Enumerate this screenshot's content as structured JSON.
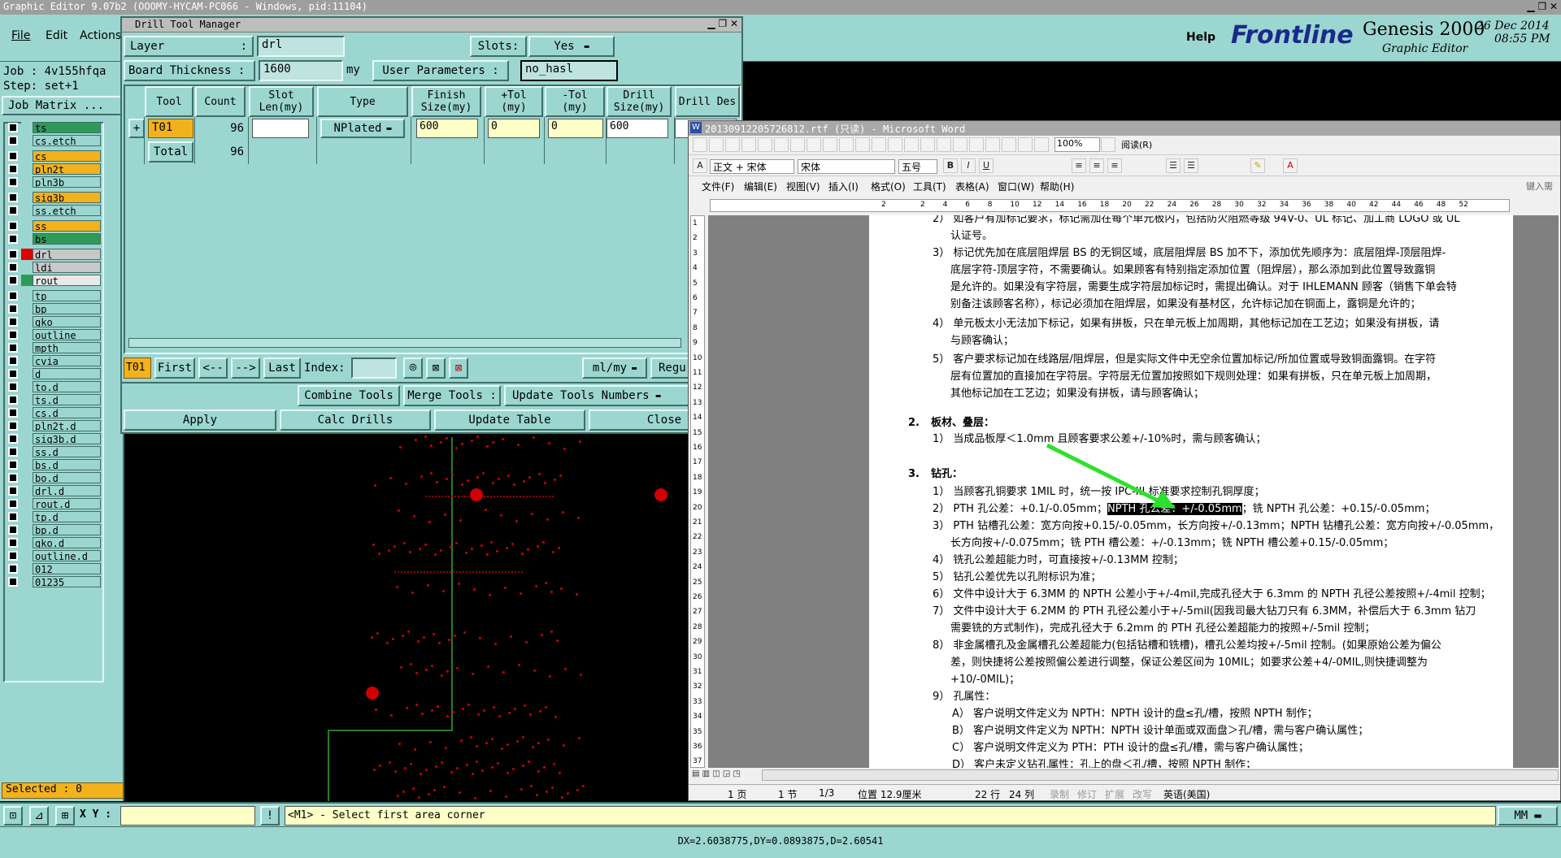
{
  "genesis": {
    "title": "Graphic Editor 9.07b2 (OOOMY-HYCAM-PC066 - Windows, pid:11104)",
    "menu": [
      "File",
      "Edit",
      "Actions"
    ],
    "help": "Help",
    "brand": "Frontline",
    "product": "Genesis 2000",
    "subtitle": "Graphic Editor",
    "date": "26 Dec 2014",
    "time": "08:55 PM",
    "job": "Job : 4v155hfqa",
    "step": "Step: set+1",
    "job_matrix": "Job Matrix ...",
    "selected": "Selected : 0",
    "xy_label": "X Y :",
    "xy_value": "",
    "status_message": "<M1> - Select first area corner",
    "units": "MM",
    "bottom_readout": "DX=2.6038775,DY=0.0893875,D=2.60541",
    "layers": [
      {
        "name": "ts",
        "color": "#2f9a58"
      },
      {
        "name": "cs.etch",
        "color": "#9cd6d0"
      },
      {
        "name": "cs",
        "color": "#f2b21e"
      },
      {
        "name": "pln2t",
        "color": "#f2b21e"
      },
      {
        "name": "pln3b",
        "color": "#9cd6d0"
      },
      {
        "name": "sig3b",
        "color": "#f2b21e"
      },
      {
        "name": "ss.etch",
        "color": "#9cd6d0"
      },
      {
        "name": "ss",
        "color": "#f2b21e"
      },
      {
        "name": "bs",
        "color": "#2f9a58"
      },
      {
        "name": "drl",
        "color": "#c8c8c8"
      },
      {
        "name": "ldi",
        "color": "#c8c8c8"
      },
      {
        "name": "rout",
        "color": "#e8e8e8"
      },
      {
        "name": "tp",
        "color": "#9cd6d0"
      },
      {
        "name": "bp",
        "color": "#9cd6d0"
      },
      {
        "name": "gko",
        "color": "#9cd6d0"
      },
      {
        "name": "outline",
        "color": "#9cd6d0"
      },
      {
        "name": "mpth",
        "color": "#9cd6d0"
      },
      {
        "name": "cvia",
        "color": "#9cd6d0"
      },
      {
        "name": "d",
        "color": "#9cd6d0"
      },
      {
        "name": "to.d",
        "color": "#9cd6d0"
      },
      {
        "name": "ts.d",
        "color": "#9cd6d0"
      },
      {
        "name": "cs.d",
        "color": "#9cd6d0"
      },
      {
        "name": "pln2t.d",
        "color": "#9cd6d0"
      },
      {
        "name": "sig3b.d",
        "color": "#9cd6d0"
      },
      {
        "name": "ss.d",
        "color": "#9cd6d0"
      },
      {
        "name": "bs.d",
        "color": "#9cd6d0"
      },
      {
        "name": "bo.d",
        "color": "#9cd6d0"
      },
      {
        "name": "drl.d",
        "color": "#9cd6d0"
      },
      {
        "name": "rout.d",
        "color": "#9cd6d0"
      },
      {
        "name": "tp.d",
        "color": "#9cd6d0"
      },
      {
        "name": "bp.d",
        "color": "#9cd6d0"
      },
      {
        "name": "gko.d",
        "color": "#9cd6d0"
      },
      {
        "name": "outline.d",
        "color": "#9cd6d0"
      },
      {
        "name": "012",
        "color": "#9cd6d0"
      },
      {
        "name": "01235",
        "color": "#9cd6d0"
      }
    ]
  },
  "drill": {
    "title": "Drill Tool Manager",
    "layer_label": "Layer",
    "layer_colon": ":",
    "layer_value": "drl",
    "slots_label": "Slots:",
    "slots_value": "Yes",
    "thickness_label": "Board Thickness :",
    "thickness_value": "1600",
    "thickness_unit": "my",
    "user_params_label": "User Parameters :",
    "user_params_value": "no_hasl",
    "headers": [
      "Tool",
      "Count",
      "Slot Len(my)",
      "Type",
      "Finish Size(my)",
      "+Tol (my)",
      "-Tol (my)",
      "Drill Size(my)",
      "Drill Des"
    ],
    "row": {
      "tool": "T01",
      "count": "96",
      "slot": "",
      "type": "NPlated",
      "finish": "600",
      "ptol": "0",
      "ntol": "0",
      "drill": "600"
    },
    "total_label": "Total",
    "total_count": "96",
    "nav": {
      "current": "T01",
      "first": "First",
      "prev": "<--",
      "next": "-->",
      "last": "Last",
      "index": "Index:",
      "units": "ml/my",
      "regu": "Regu"
    },
    "combine": "Combine Tools",
    "merge": "Merge Tools :",
    "update_numbers": "Update Tools Numbers",
    "apply": "Apply",
    "calc": "Calc Drills",
    "update_table": "Update Table",
    "close": "Close"
  },
  "word": {
    "title": "20130912205726812.rtf (只读) - Microsoft Word",
    "zoom": "100%",
    "read_btn": "阅读(R)",
    "style": "正文 + 宋体",
    "font": "宋体",
    "size": "五号",
    "menus": [
      "文件(F)",
      "编辑(E)",
      "视图(V)",
      "插入(I)",
      "格式(O)",
      "工具(T)",
      "表格(A)",
      "窗口(W)",
      "帮助(H)"
    ],
    "ask": "键入需",
    "ruler": [
      "2",
      "2",
      "4",
      "6",
      "8",
      "10",
      "12",
      "14",
      "16",
      "18",
      "20",
      "22",
      "24",
      "26",
      "28",
      "30",
      "32",
      "34",
      "36",
      "38",
      "40",
      "42",
      "44",
      "46",
      "48",
      "52"
    ],
    "vruler": [
      "1",
      "2",
      "3",
      "4",
      "5",
      "6",
      "7",
      "8",
      "9",
      "10",
      "11",
      "12",
      "13",
      "14",
      "15",
      "16",
      "17",
      "18",
      "19",
      "20",
      "21",
      "22",
      "23",
      "24",
      "25",
      "26",
      "27",
      "28",
      "29",
      "30",
      "31",
      "32",
      "33",
      "34",
      "35",
      "36",
      "37"
    ],
    "status": {
      "page": "1 页",
      "section": "1 节",
      "pages": "1/3",
      "pos": "位置 12.9厘米",
      "line": "22 行",
      "col": "24 列",
      "rec": "录制",
      "trk": "修订",
      "ext": "扩展",
      "ovr": "改写",
      "lang": "英语(美国)"
    },
    "lines": [
      "2） 如客户有加标记要求，标记需加在每个单元板内，包括防火阻燃等级 94V-0、UL 标记、加工商 LOGO 或 UL",
      "认证号。",
      "3） 标记优先加在底层阻焊层 BS 的无铜区域，底层阻焊层 BS 加不下，添加优先顺序为：底层阻焊-顶层阻焊-",
      "底层字符-顶层字符，不需要确认。如果顾客有特别指定添加位置（阻焊层），那么添加到此位置导致露铜",
      "是允许的。如果没有字符层，需要生成字符层加标记时，需提出确认。对于 IHLEMANN 顾客（销售下单会特",
      "别备注该顾客名称），标记必须加在阻焊层，如果没有基材区，允许标记加在铜面上，露铜是允许的；",
      "4） 单元板太小无法加下标记，如果有拼板，只在单元板上加周期，其他标记加在工艺边；如果没有拼板，请",
      "与顾客确认；",
      "5） 客户要求标记加在线路层/阻焊层，但是实际文件中无空余位置加标记/所加位置或导致铜面露铜。在字符",
      "层有位置加的直接加在字符层。字符层无位置加按照如下规则处理：如果有拼板，只在单元板上加周期，",
      "其他标记加在工艺边；如果没有拼板，请与顾客确认；",
      "板材、叠层：",
      "1） 当成品板厚＜1.0mm 且顾客要求公差+/-10%时，需与顾客确认；",
      "钻孔：",
      "1） 当顾客孔铜要求 1MIL 时，统一按 IPC-III 标准要求控制孔铜厚度；",
      "2） PTH 孔公差：+0.1/-0.05mm；",
      "NPTH 孔公差：+/-0.05mm",
      "；铣 NPTH 孔公差：+0.15/-0.05mm；",
      "3） PTH 钻槽孔公差：宽方向按+0.15/-0.05mm，长方向按+/-0.13mm；NPTH 钻槽孔公差：宽方向按+/-0.05mm，",
      "长方向按+/-0.075mm；铣 PTH 槽公差：+/-0.13mm；铣 NPTH 槽公差+0.15/-0.05mm；",
      "4） 铣孔公差超能力时，可直接按+/-0.13MM 控制；",
      "5） 钻孔公差优先以孔附标识为准；",
      "6） 文件中设计大于 6.3MM 的 NPTH 公差小于+/-4mil,完成孔径大于 6.3mm 的 NPTH 孔径公差按照+/-4mil 控制；",
      "7） 文件中设计大于 6.2MM 的 PTH 孔径公差小于+/-5mil(因我司最大钻刀只有 6.3MM，补偿后大于 6.3mm 钻刀",
      "需要铣的方式制作)，完成孔径大于 6.2mm 的 PTH 孔径公差超能力的按照+/-5mil 控制；",
      "8） 非金属槽孔及金属槽孔公差超能力(包括钻槽和铣槽)，槽孔公差均按+/-5mil 控制。(如果原始公差为偏公",
      "差，则快捷将公差按照偏公差进行调整，保证公差区间为 10MIL；如要求公差+4/-0MIL,则快捷调整为",
      "+10/-0MIL)；",
      "9） 孔属性：",
      "A） 客户说明文件定义为 NPTH：NPTH 设计的盘≤孔/槽，按照 NPTH 制作；",
      "B） 客户说明文件定义为 NPTH：NPTH 设计单面或双面盘＞孔/槽，需与客户确认属性；",
      "C） 客户说明文件定义为 PTH：PTH 设计的盘≤孔/槽，需与客户确认属性；",
      "D） 客户未定义钻孔属性：孔上的盘＜孔/槽，按照 NPTH 制作；"
    ],
    "heading_nums": [
      "2.",
      "3."
    ]
  }
}
